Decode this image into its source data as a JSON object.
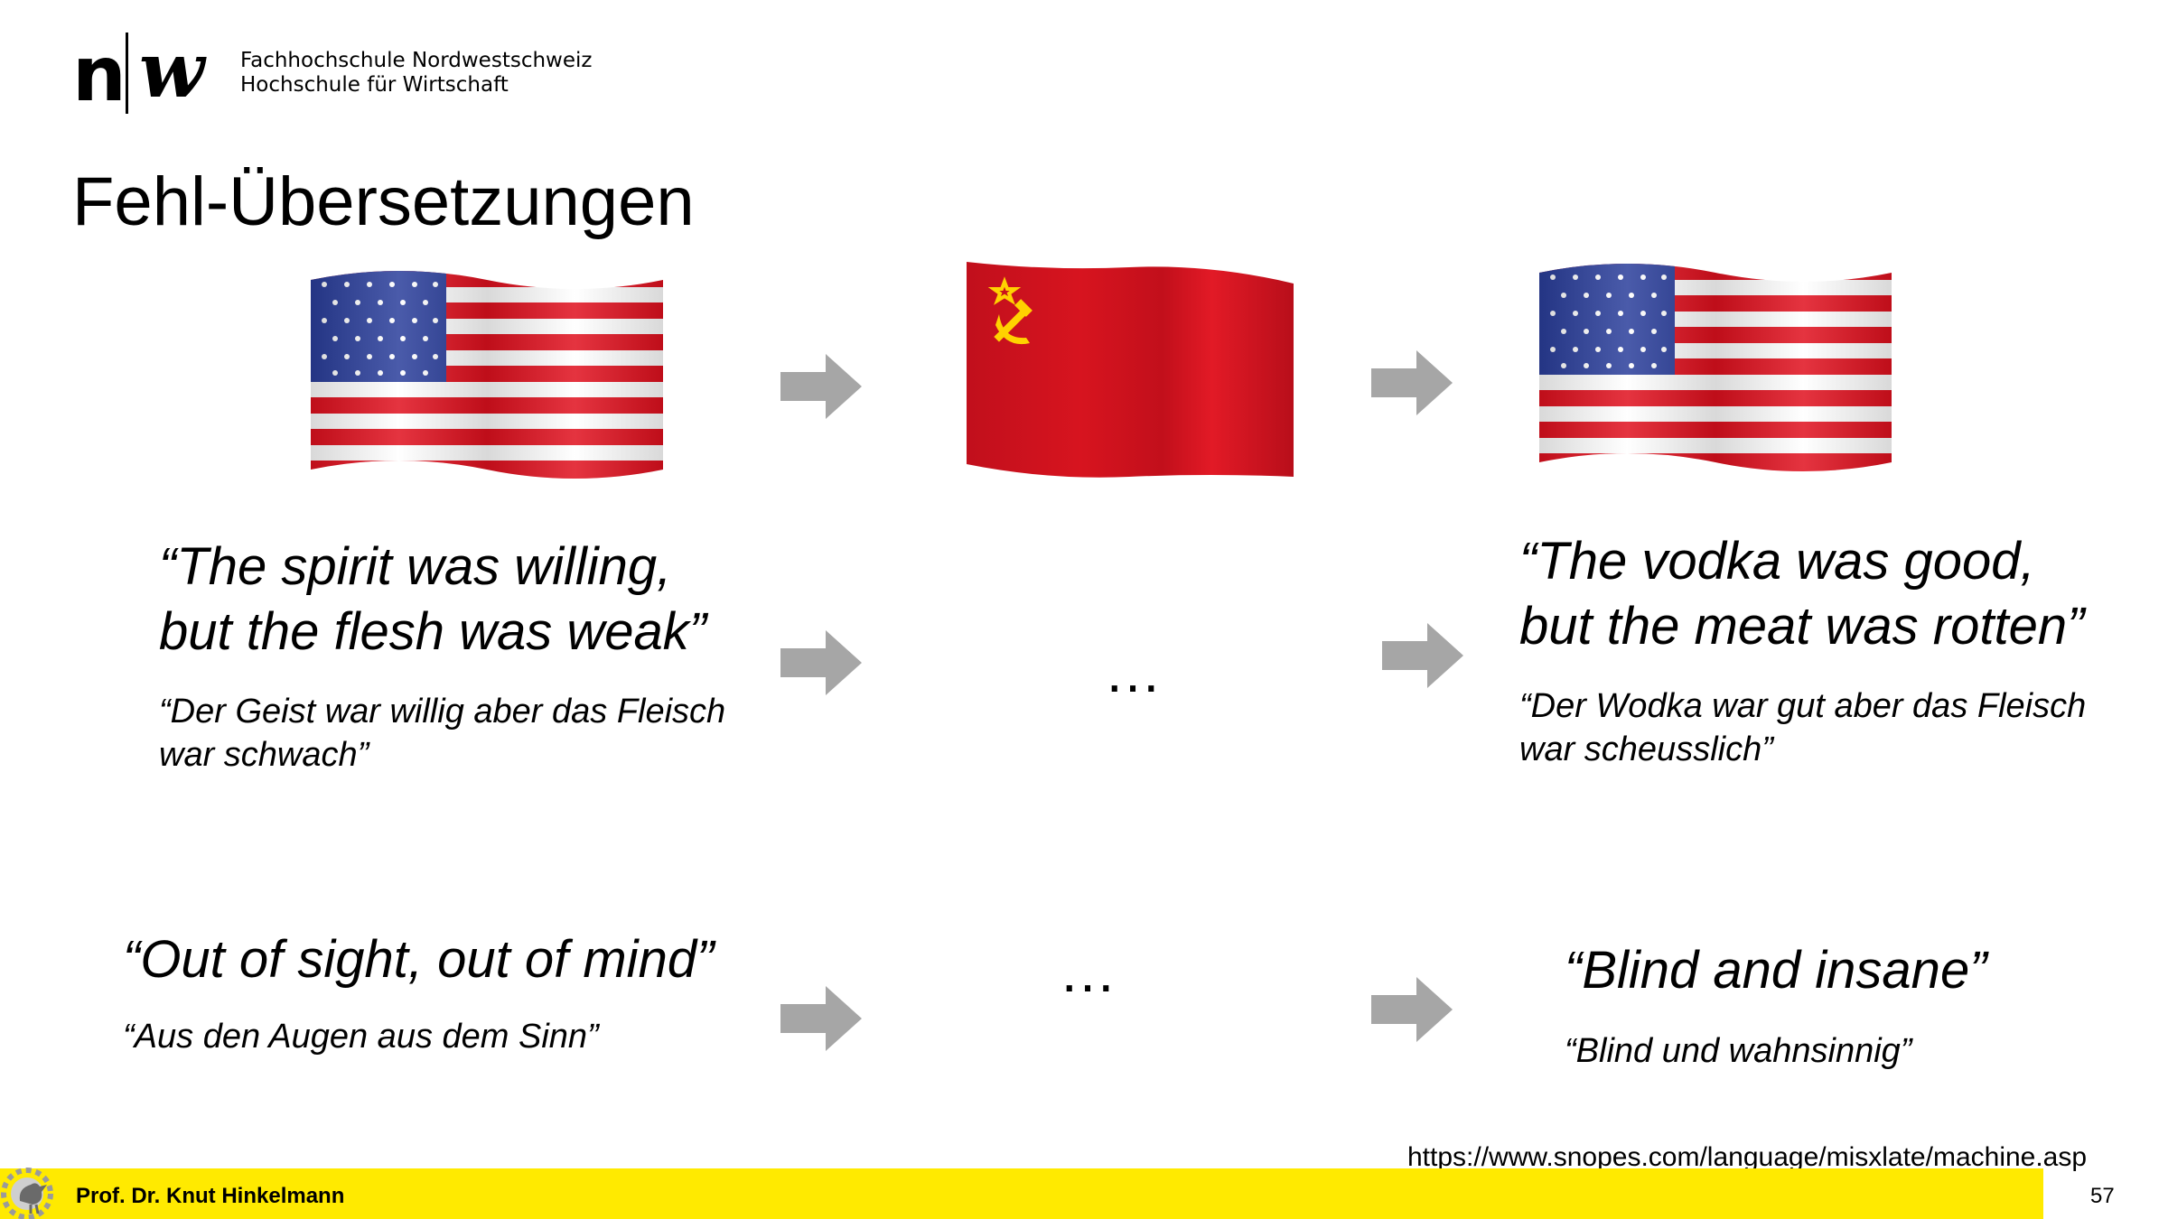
{
  "header": {
    "logo_text_line1": "Fachhochschule Nordwestschweiz",
    "logo_text_line2": "Hochschule für Wirtschaft"
  },
  "slide": {
    "title": "Fehl-Übersetzungen"
  },
  "example1": {
    "source_en_line1": "“The spirit was willing,",
    "source_en_line2": "but the flesh was weak”",
    "source_de_line1": "“Der Geist war willig aber das Fleisch",
    "source_de_line2": "war schwach”",
    "middle": "…",
    "result_en_line1": "“The vodka was good,",
    "result_en_line2": "but the meat was rotten”",
    "result_de_line1": "“Der Wodka war gut aber das Fleisch",
    "result_de_line2": "war scheusslich”"
  },
  "example2": {
    "source_en": "“Out of sight, out of mind”",
    "source_de": "“Aus den Augen aus dem Sinn”",
    "middle": "…",
    "result_en": "“Blind and insane”",
    "result_de": "“Blind und wahnsinnig”"
  },
  "source_url": "https://www.snopes.com/language/misxlate/machine.asp",
  "footer": {
    "author": "Prof. Dr. Knut Hinkelmann",
    "page_number": "57"
  },
  "icons": {
    "flag_left": "us-flag-icon",
    "flag_middle": "soviet-flag-icon",
    "flag_right": "us-flag-icon",
    "arrow": "arrow-right-icon",
    "footer": "rooster-gear-icon"
  },
  "colors": {
    "footer_bar": "#ffea00",
    "arrow": "#a6a6a6",
    "flag_red": "#d4121f",
    "flag_blue": "#2a3e9b"
  }
}
